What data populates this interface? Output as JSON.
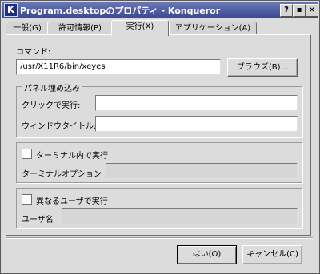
{
  "window": {
    "title": "Program.desktopのプロパティ - Konqueror",
    "app_icon_letter": "K",
    "controls": {
      "help": "?",
      "maximize": "▪",
      "close": "×"
    }
  },
  "tabs": [
    {
      "label": "一般(G)"
    },
    {
      "label": "許可情報(P)"
    },
    {
      "label": "実行(X)"
    },
    {
      "label": "アプリケーション(A)"
    }
  ],
  "exec": {
    "command_label": "コマンド:",
    "command_value": "/usr/X11R6/bin/xeyes",
    "browse_button": "ブラウズ(B)...",
    "panel_embed": {
      "title": "パネル埋め込み",
      "click_exec_label": "クリックで実行:",
      "click_exec_value": "",
      "window_title_label": "ウィンドウタイトル:",
      "window_title_value": ""
    },
    "terminal": {
      "checkbox_label": "ターミナル内で実行",
      "checked": false,
      "options_label": "ターミナルオプション",
      "options_value": ""
    },
    "other_user": {
      "checkbox_label": "異なるユーザで実行",
      "checked": false,
      "username_label": "ユーザ名",
      "username_value": ""
    }
  },
  "footer": {
    "ok_button": "はい(O)",
    "cancel_button": "キャンセル(C)"
  }
}
